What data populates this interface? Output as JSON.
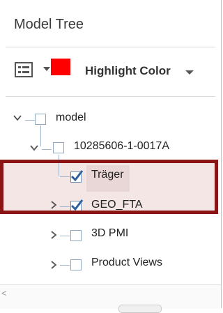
{
  "panel": {
    "title": "Model Tree"
  },
  "toolbar": {
    "options_icon": "list-options-icon",
    "highlight_color_hex": "#ff0000",
    "highlight_color_label": "Highlight Color"
  },
  "tree": {
    "items": [
      {
        "label": "model",
        "expanded": true,
        "checked": false
      },
      {
        "label": "10285606-1-0017A",
        "expanded": true,
        "checked": false
      },
      {
        "label": "Träger",
        "expanded": null,
        "checked": true,
        "selected": true
      },
      {
        "label": "GEO_FTA",
        "expanded": false,
        "checked": true
      },
      {
        "label": "3D PMI",
        "expanded": false,
        "checked": false
      },
      {
        "label": "Product Views",
        "expanded": false,
        "checked": false
      }
    ]
  },
  "colors": {
    "annotation_frame": "#8b1414",
    "selection_background": "#e9d6d6"
  },
  "scrollbar": {
    "left_arrow": "<"
  }
}
